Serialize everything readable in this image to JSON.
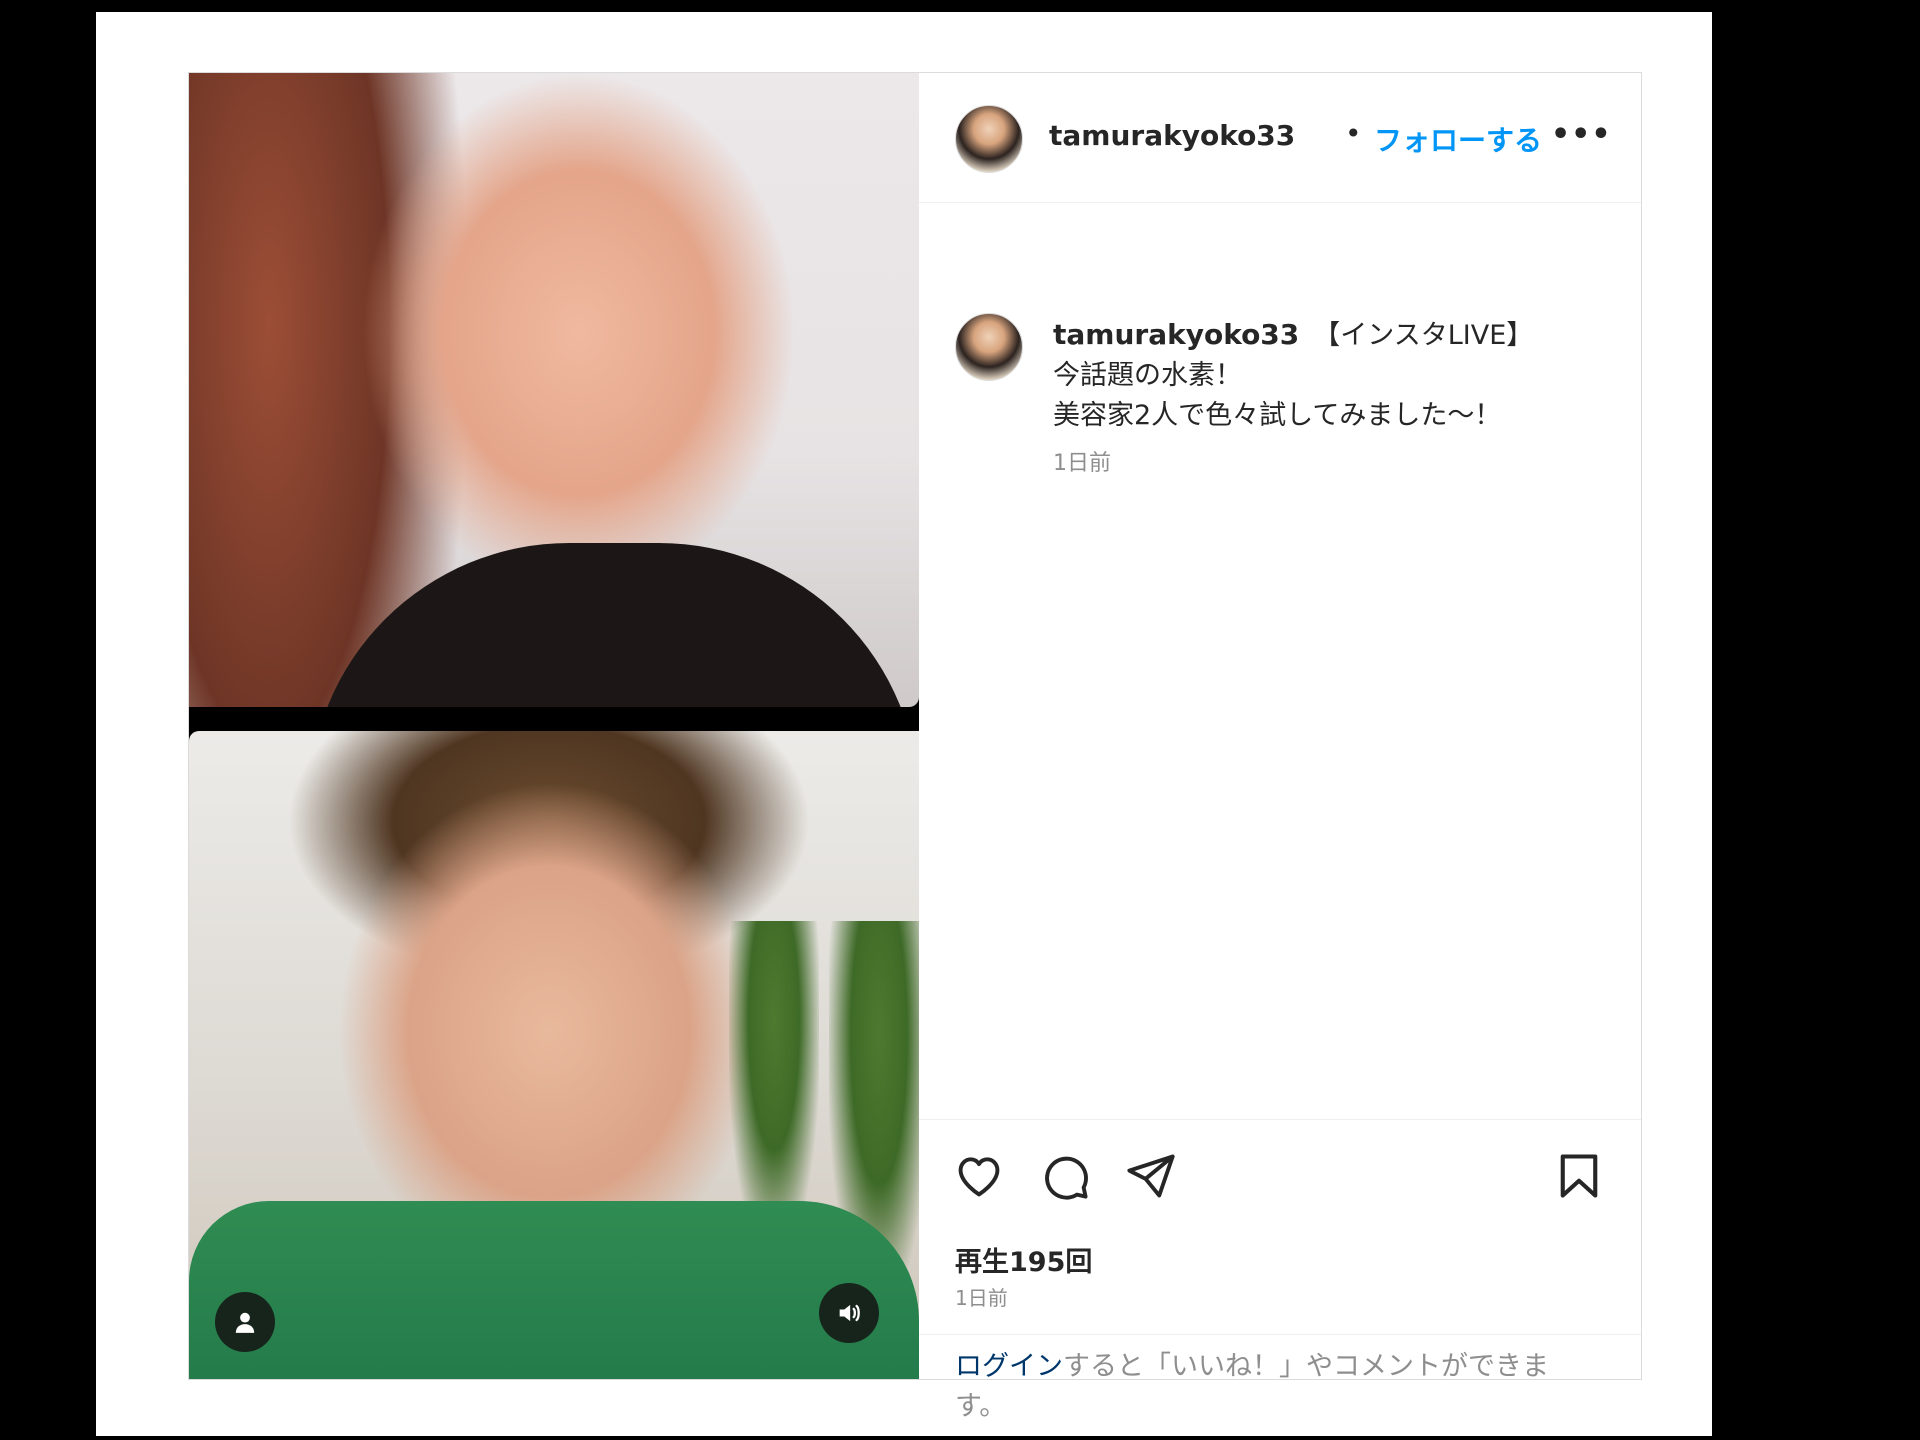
{
  "header": {
    "username": "tamurakyoko33",
    "separator": "•",
    "follow_label": "フォローする",
    "more_label": "•••"
  },
  "caption": {
    "username": "tamurakyoko33",
    "line1": "【インスタLIVE】",
    "line2": "今話題の水素！",
    "line3": "美容家2人で色々試してみました〜！",
    "time": "1日前"
  },
  "actions": {
    "icons": [
      "heart-icon",
      "comment-icon",
      "share-icon",
      "bookmark-icon"
    ],
    "views": "再生195回",
    "time": "1日前"
  },
  "login": {
    "link_text": "ログイン",
    "rest_text": "すると「いいね！」やコメントができます。"
  },
  "video": {
    "controls": [
      "user-icon",
      "sound-icon"
    ]
  },
  "colors": {
    "accent": "#0095f6",
    "login_link": "#00376b",
    "text": "#262626",
    "muted": "#8e8e8e"
  }
}
